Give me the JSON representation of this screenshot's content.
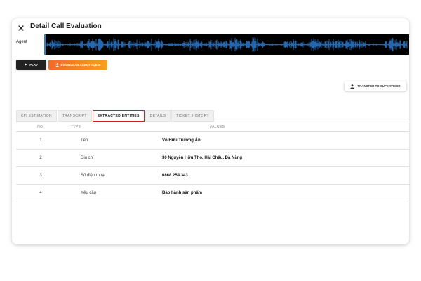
{
  "header": {
    "title": "Detail Call Evaluation",
    "close_icon": "close-icon"
  },
  "waveform": {
    "label": "Agent",
    "color": "#2f80d8",
    "background": "#000000"
  },
  "buttons": {
    "play": "PLAY",
    "download": "DOWNLOAD AGENT AUDIO",
    "transfer": "TRANSFER TO SUPERVISOR"
  },
  "tabs": [
    {
      "label": "KPI ESTIMATION",
      "active": false
    },
    {
      "label": "TRANSCRIPT",
      "active": false
    },
    {
      "label": "EXTRACTED ENTITIES",
      "active": true
    },
    {
      "label": "DETAILS",
      "active": false
    },
    {
      "label": "TICKET_HISTORY",
      "active": false
    }
  ],
  "table": {
    "headers": {
      "no": "NO.",
      "type": "TYPE",
      "values": "VALUES"
    },
    "rows": [
      {
        "no": "1",
        "type": "Tên",
        "value": "Võ Hữu Trường Ân"
      },
      {
        "no": "2",
        "type": "Địa chỉ",
        "value": "30 Nguyễn Hữu Thọ, Hải Châu, Đà Nẵng"
      },
      {
        "no": "3",
        "type": "Số điện thoại",
        "value": "0868 254 343"
      },
      {
        "no": "4",
        "type": "Yêu cầu",
        "value": "Bảo hành sản phẩm"
      }
    ]
  },
  "colors": {
    "accent_orange": "#f26a2a",
    "active_tab_outline": "#d21f1f"
  }
}
